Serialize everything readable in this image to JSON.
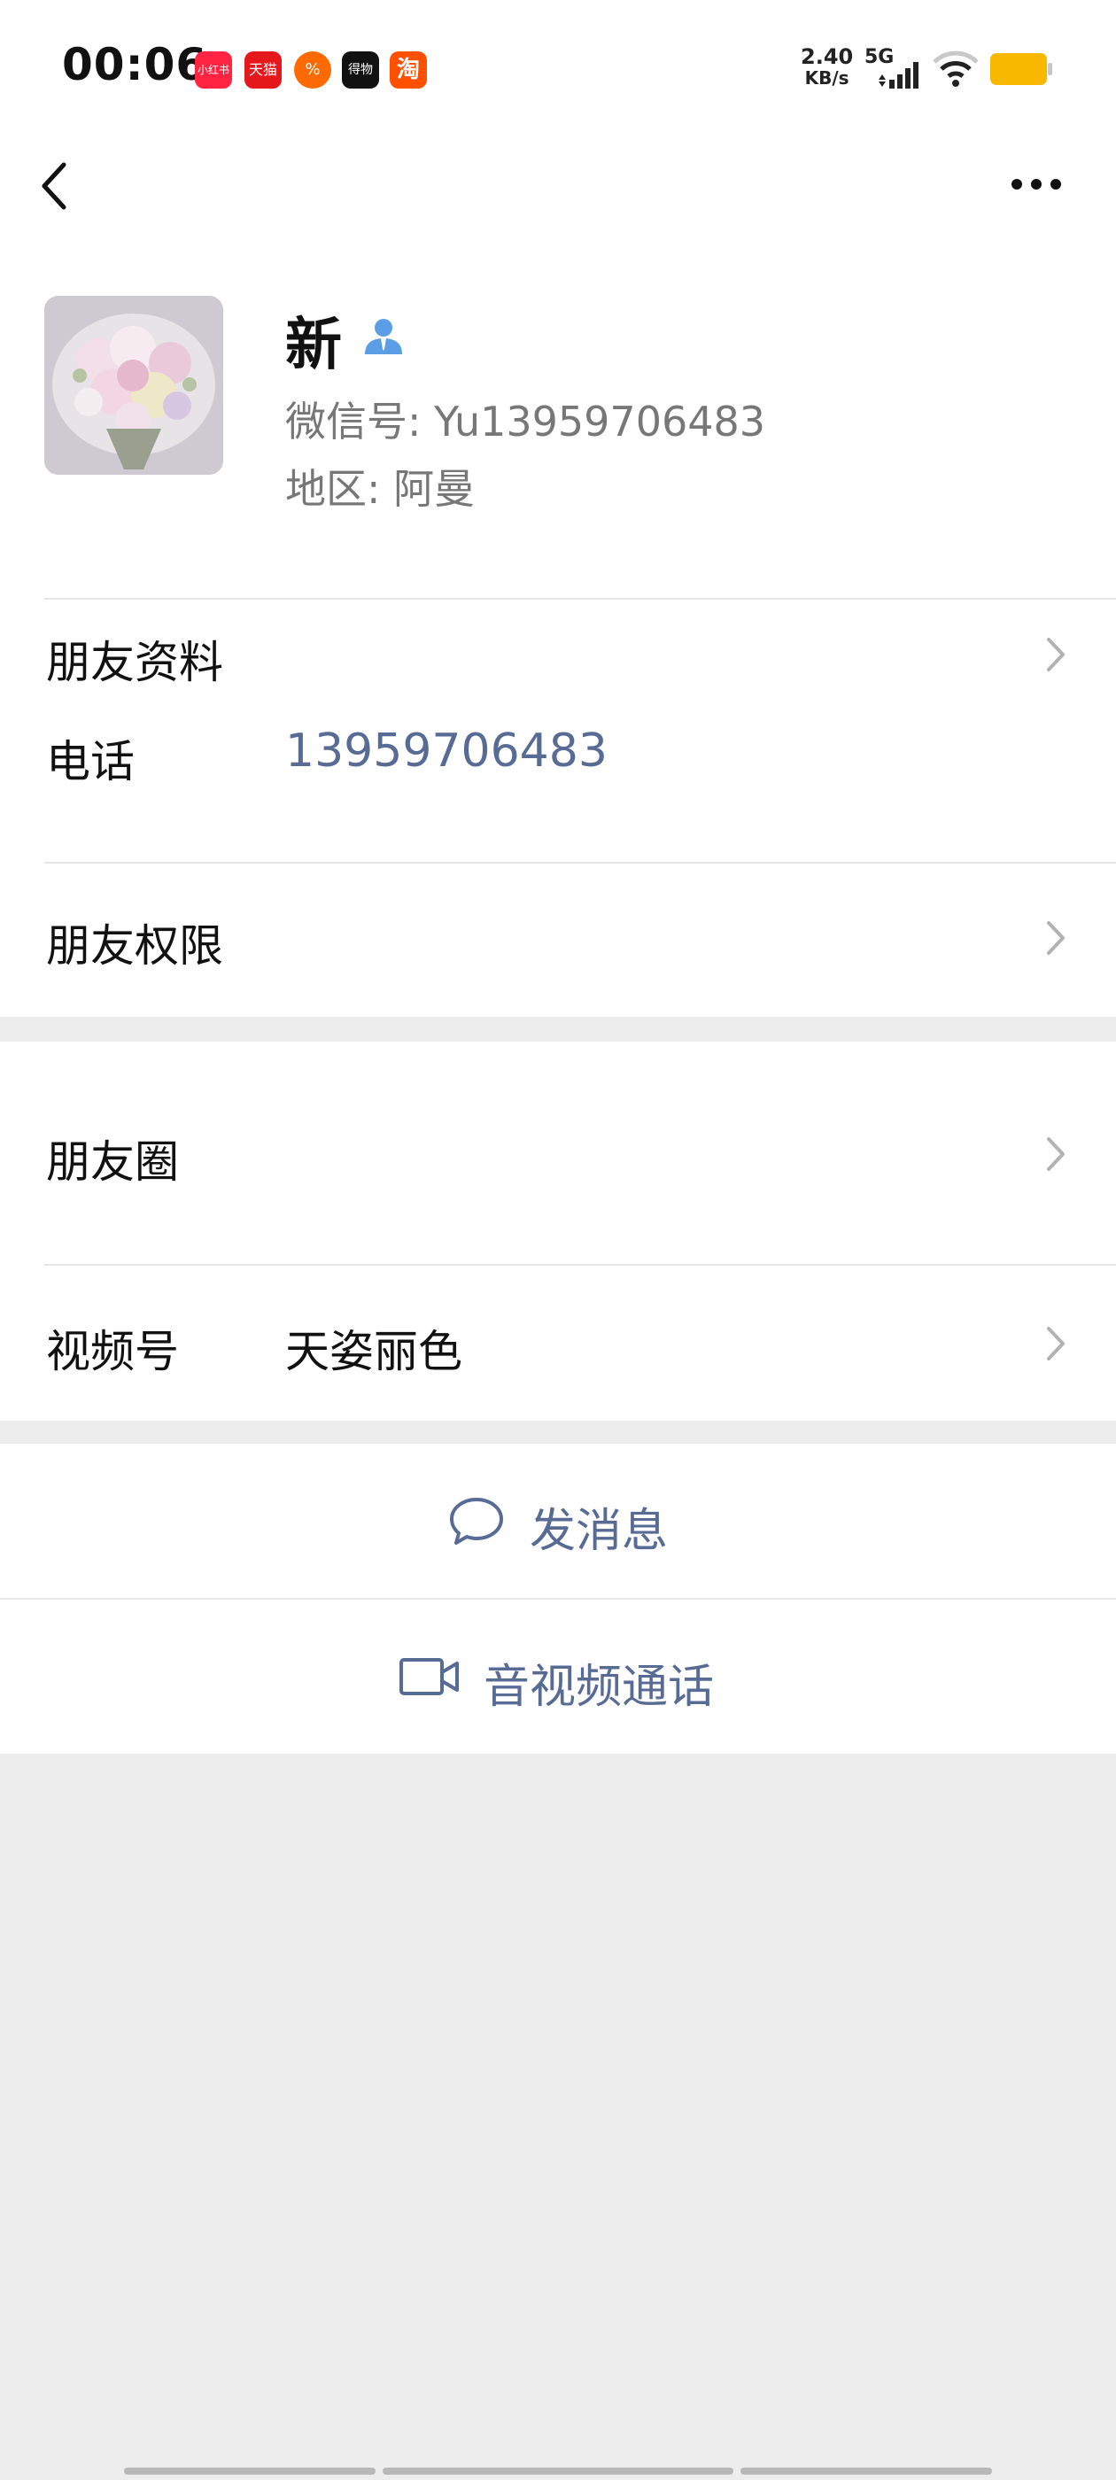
{
  "status_bar": {
    "time": "00:06",
    "apps": [
      {
        "name": "xiaohongshu-app-icon",
        "label": "小红书",
        "color": "#ff2442"
      },
      {
        "name": "tmall-app-icon",
        "label": "天猫",
        "color": "#e5181c"
      },
      {
        "name": "app-icon-orange",
        "label": "%",
        "color": "#ff6a00"
      },
      {
        "name": "dewu-app-icon",
        "label": "得物",
        "color": "#111111"
      },
      {
        "name": "taobao-app-icon",
        "label": "淘",
        "color": "#ff5000"
      }
    ],
    "speed_value": "2.40",
    "speed_unit": "KB/s",
    "network": "5G",
    "battery_color": "#f8b800"
  },
  "profile": {
    "name": "新",
    "wechat_id": "微信号: Yu13959706483",
    "region": "地区: 阿曼"
  },
  "rows": {
    "friend_info": "朋友资料",
    "phone_label": "电话",
    "phone_value": "13959706483",
    "permissions": "朋友权限",
    "moments": "朋友圈",
    "channels_label": "视频号",
    "channels_value": "天姿丽色"
  },
  "actions": {
    "message": "发消息",
    "call": "音视频通话"
  },
  "colors": {
    "link_blue": "#576b95",
    "background_gray": "#ededed"
  }
}
